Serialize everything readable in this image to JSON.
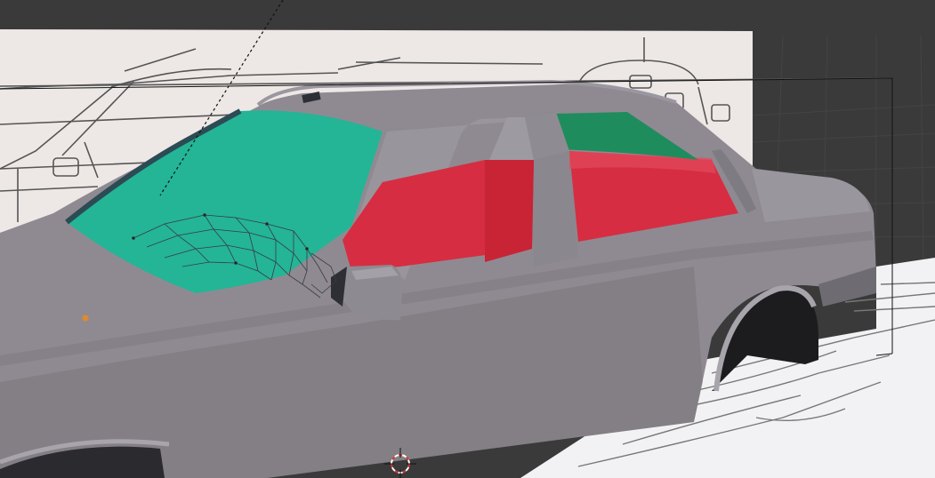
{
  "viewport": {
    "label": "3D Viewport",
    "colors": {
      "background": "#3a3a3a",
      "grid": "#444444",
      "reference_paper": "#ede8e6",
      "ground_paper": "#f2f2f4",
      "car_body": "#8f8a91",
      "car_body_shadow": "#6c6970",
      "windshield": "#23b596",
      "rear_window": "#1f8c5e",
      "interior_red": "#d62d42",
      "origin_point": "#e08a2a",
      "cursor_red": "#d23a3a"
    }
  },
  "objects": {
    "car_body": "car-body",
    "windshield": "windshield",
    "interior": "interior",
    "side_mirror": "side-mirror",
    "wheel_arch_rear": "wheel-arch-rear",
    "wireframe_dashboard": "wireframe-mesh"
  },
  "overlays": {
    "origin_marker": "origin-point",
    "cursor_3d": "3d-cursor",
    "bounding_box": "bounding-box"
  }
}
